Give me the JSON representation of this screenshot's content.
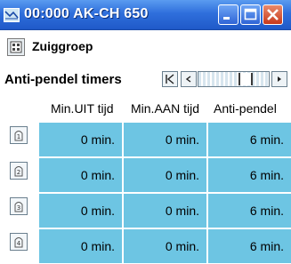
{
  "window": {
    "title": "00:000 AK-CH 650",
    "title_bar_color": "#2f6fdc",
    "close_button_color": "#c8391b"
  },
  "group": {
    "icon": "device-group-icon",
    "label": "Zuiggroep"
  },
  "section": {
    "label": "Anti-pendel timers",
    "nav": {
      "first_icon": "skip-first-icon",
      "prev_icon": "prev-icon",
      "next_icon": "next-icon"
    }
  },
  "table": {
    "headers": [
      "Min.UIT tijd",
      "Min.AAN tijd",
      "Anti-pendel"
    ],
    "cell_color": "#6dc5e3",
    "rows": [
      {
        "icon": "compressor-1-icon",
        "cells": [
          "0 min.",
          "0 min.",
          "6 min."
        ]
      },
      {
        "icon": "compressor-2-icon",
        "cells": [
          "0 min.",
          "0 min.",
          "6 min."
        ]
      },
      {
        "icon": "compressor-3-icon",
        "cells": [
          "0 min.",
          "0 min.",
          "6 min."
        ]
      },
      {
        "icon": "compressor-4-icon",
        "cells": [
          "0 min.",
          "0 min.",
          "6 min."
        ]
      }
    ]
  }
}
